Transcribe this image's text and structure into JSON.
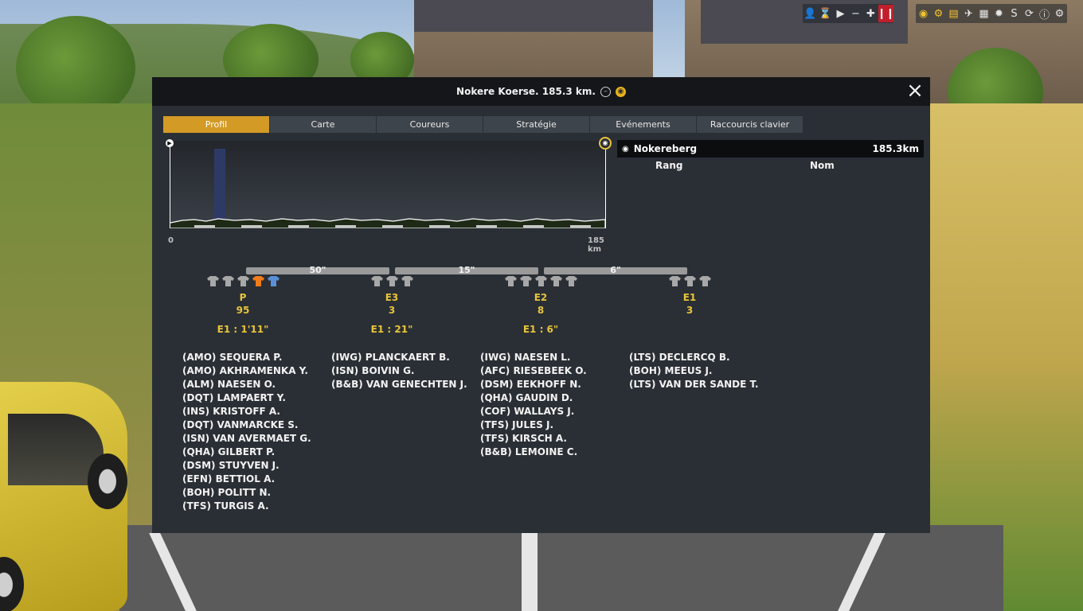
{
  "dialog": {
    "title": "Nokere Koerse. 185.3 km.",
    "close_label": "✕"
  },
  "tabs": [
    {
      "label": "Profil",
      "active": true
    },
    {
      "label": "Carte"
    },
    {
      "label": "Coureurs"
    },
    {
      "label": "Stratégie"
    },
    {
      "label": "Evénements"
    },
    {
      "label": "Raccourcis clavier"
    }
  ],
  "profile": {
    "start_km": "0",
    "end_km": "185 km"
  },
  "climb": {
    "name": "Nokereberg",
    "distance": "185.3km",
    "col_rank": "Rang",
    "col_name": "Nom"
  },
  "gaps": [
    "50\"",
    "15\"",
    "6\""
  ],
  "groups": [
    {
      "code": "P",
      "count": "95",
      "time": "E1 : 1'11\"",
      "jerseys": [
        "grey",
        "grey",
        "grey",
        "orange",
        "blue"
      ],
      "riders": [
        "(AMO) SEQUERA P.",
        "(AMO) AKHRAMENKA Y.",
        "(ALM) NAESEN O.",
        "(DQT) LAMPAERT Y.",
        "(INS) KRISTOFF A.",
        "(DQT) VANMARCKE S.",
        "(ISN) VAN AVERMAET G.",
        "(QHA) GILBERT P.",
        "(DSM) STUYVEN J.",
        "(EFN) BETTIOL A.",
        "(BOH) POLITT N.",
        "(TFS) TURGIS A."
      ]
    },
    {
      "code": "E3",
      "count": "3",
      "time": "E1 : 21\"",
      "jerseys": [
        "grey",
        "grey",
        "grey"
      ],
      "riders": [
        "(IWG) PLANCKAERT B.",
        "(ISN) BOIVIN G.",
        "(B&B) VAN GENECHTEN J."
      ]
    },
    {
      "code": "E2",
      "count": "8",
      "time": "E1 : 6\"",
      "jerseys": [
        "grey",
        "grey",
        "grey",
        "grey",
        "grey"
      ],
      "riders": [
        "(IWG) NAESEN L.",
        "(AFC) RIESEBEEK O.",
        "(DSM) EEKHOFF N.",
        "(QHA) GAUDIN D.",
        "(COF) WALLAYS J.",
        "(TFS) JULES J.",
        "(TFS) KIRSCH A.",
        "(B&B) LEMOINE C."
      ]
    },
    {
      "code": "E1",
      "count": "3",
      "time": "",
      "jerseys": [
        "grey",
        "grey",
        "grey"
      ],
      "riders": [
        "(LTS) DECLERCQ B.",
        "(BOH) MEEUS J.",
        "(LTS) VAN DER SANDE T."
      ]
    }
  ],
  "colors": {
    "accent": "#d49a26",
    "group_text": "#e8c43a",
    "jersey_grey": "#a8a8a8",
    "jersey_orange": "#f07c1a",
    "jersey_blue": "#5a8fd8"
  }
}
